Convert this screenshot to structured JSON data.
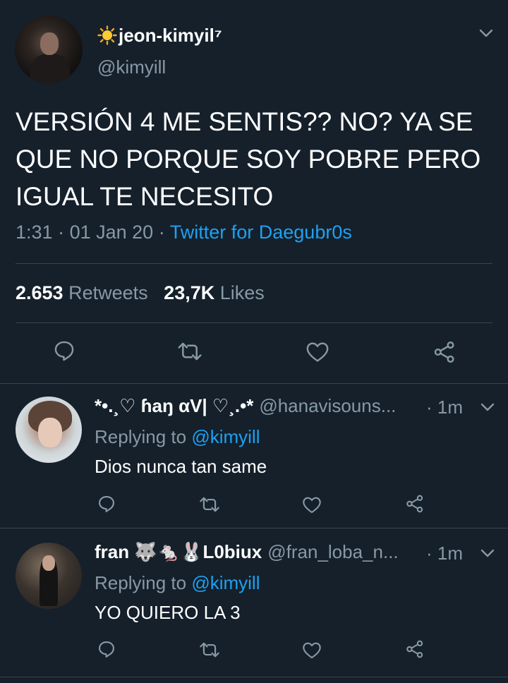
{
  "tweet": {
    "author_name": "jeon-kimyil⁷",
    "author_handle": "@kimyill",
    "text": "VERSIÓN 4 ME SENTIS?? NO? YA SE QUE NO PORQUE SOY POBRE PERO IGUAL TE NECESITO",
    "time": "1:31",
    "date": "01 Jan 20",
    "separator": "·",
    "source": "Twitter for Daegubr0s",
    "retweets_count": "2.653",
    "retweets_label": "Retweets",
    "likes_count": "23,7K",
    "likes_label": "Likes"
  },
  "replies": [
    {
      "name": "*•.¸♡ ɦaŋ αV| ♡¸.•*",
      "handle": "@hanavisouns...",
      "time": "· 1m",
      "replying_label": "Replying to",
      "replying_handle": "@kimyill",
      "text": "Dios nunca tan same"
    },
    {
      "name": "fran 🐺🐁🐰L0biux",
      "handle": "@fran_loba_n...",
      "time": "· 1m",
      "replying_label": "Replying to",
      "replying_handle": "@kimyill",
      "text": "YO QUIERO LA 3"
    }
  ],
  "colors": {
    "background": "#15202b",
    "text_secondary": "#8899a6",
    "link": "#1da1f2",
    "divider": "#38444d"
  },
  "icons": [
    "sun-icon",
    "chevron-down-icon",
    "reply-icon",
    "retweet-icon",
    "like-icon",
    "share-icon"
  ]
}
